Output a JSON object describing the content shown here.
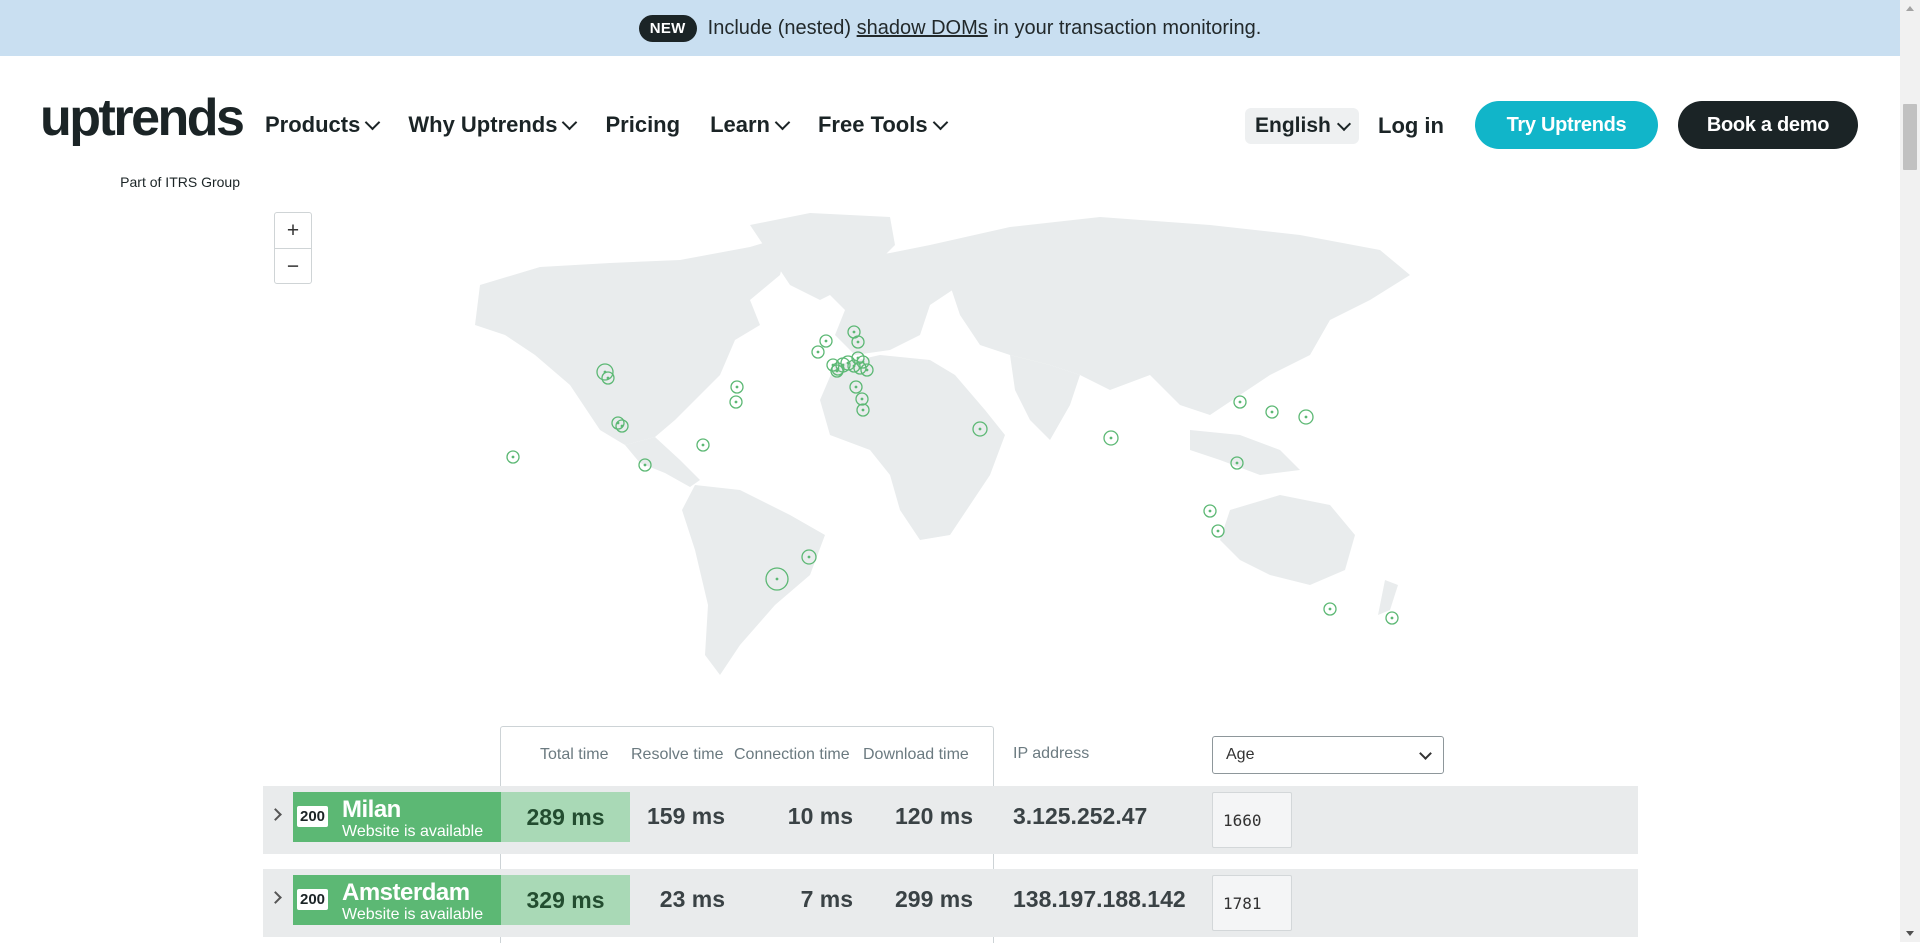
{
  "banner": {
    "badge": "NEW",
    "text_before": "Include (nested) ",
    "link": "shadow DOMs",
    "text_after": " in your transaction monitoring."
  },
  "logo": {
    "wordmark": "uptrends",
    "tagline": "Part of ITRS Group"
  },
  "nav": {
    "items": [
      {
        "label": "Products",
        "dropdown": true
      },
      {
        "label": "Why Uptrends",
        "dropdown": true
      },
      {
        "label": "Pricing",
        "dropdown": false
      },
      {
        "label": "Learn",
        "dropdown": true
      },
      {
        "label": "Free Tools",
        "dropdown": true
      }
    ]
  },
  "header": {
    "language": "English",
    "login": "Log in",
    "try": "Try Uptrends",
    "demo": "Book a demo"
  },
  "colors": {
    "accent": "#11b5c9",
    "dark": "#1b2426",
    "status_ok": "#5cb874",
    "total_time_bg": "#a9d9b6",
    "banner_bg": "#c9dff1"
  },
  "map": {
    "zoom_in": "+",
    "zoom_out": "−"
  },
  "table": {
    "headers": {
      "total": "Total time",
      "resolve": "Resolve time",
      "connection": "Connection time",
      "download": "Download time",
      "ip": "IP address",
      "sort_select": "Age"
    },
    "rows": [
      {
        "code": "200",
        "city": "Milan",
        "status": "Website is available",
        "total": "289 ms",
        "resolve": "159 ms",
        "connection": "10 ms",
        "download": "120 ms",
        "ip": "3.125.252.47",
        "age": "1660"
      },
      {
        "code": "200",
        "city": "Amsterdam",
        "status": "Website is available",
        "total": "329 ms",
        "resolve": "23 ms",
        "connection": "7 ms",
        "download": "299 ms",
        "ip": "138.197.188.142",
        "age": "1781"
      }
    ]
  }
}
